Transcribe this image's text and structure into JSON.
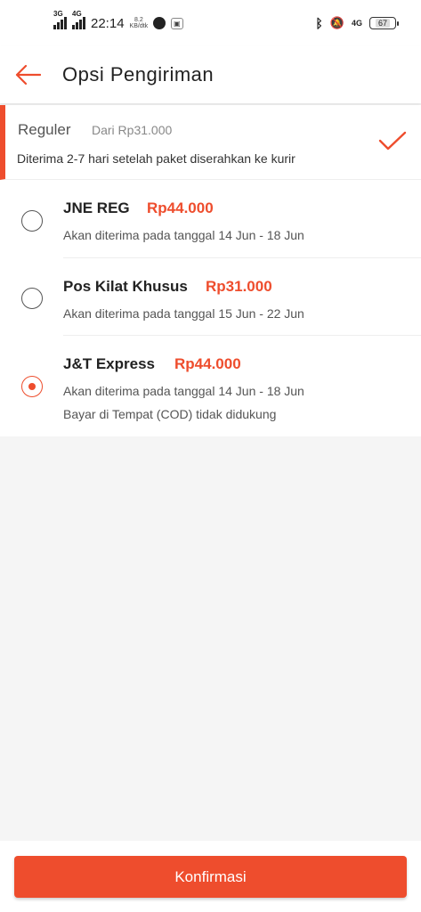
{
  "status_bar": {
    "signal_1_label": "3G",
    "signal_2_label": "4G",
    "time": "22:14",
    "speed_value": "8.2",
    "speed_unit": "KB/dtk",
    "lte_label": "4G",
    "battery_level": "67"
  },
  "header": {
    "title": "Opsi Pengiriman",
    "back_icon": "arrow-left-icon"
  },
  "group": {
    "title": "Reguler",
    "subtitle": "Dari Rp31.000",
    "description": "Diterima 2-7 hari setelah paket diserahkan ke kurir",
    "check_icon": "checkmark-icon"
  },
  "options": [
    {
      "name": "JNE REG",
      "price": "Rp44.000",
      "eta": "Akan diterima pada tanggal 14 Jun - 18 Jun",
      "note": "",
      "selected": false
    },
    {
      "name": "Pos Kilat Khusus",
      "price": "Rp31.000",
      "eta": "Akan diterima pada tanggal 15 Jun - 22 Jun",
      "note": "",
      "selected": false
    },
    {
      "name": "J&T Express",
      "price": "Rp44.000",
      "eta": "Akan diterima pada tanggal 14 Jun - 18 Jun",
      "note": "Bayar di Tempat (COD) tidak didukung",
      "selected": true
    }
  ],
  "footer": {
    "confirm_label": "Konfirmasi"
  },
  "colors": {
    "accent": "#ee4d2d",
    "background": "#f5f5f5"
  }
}
